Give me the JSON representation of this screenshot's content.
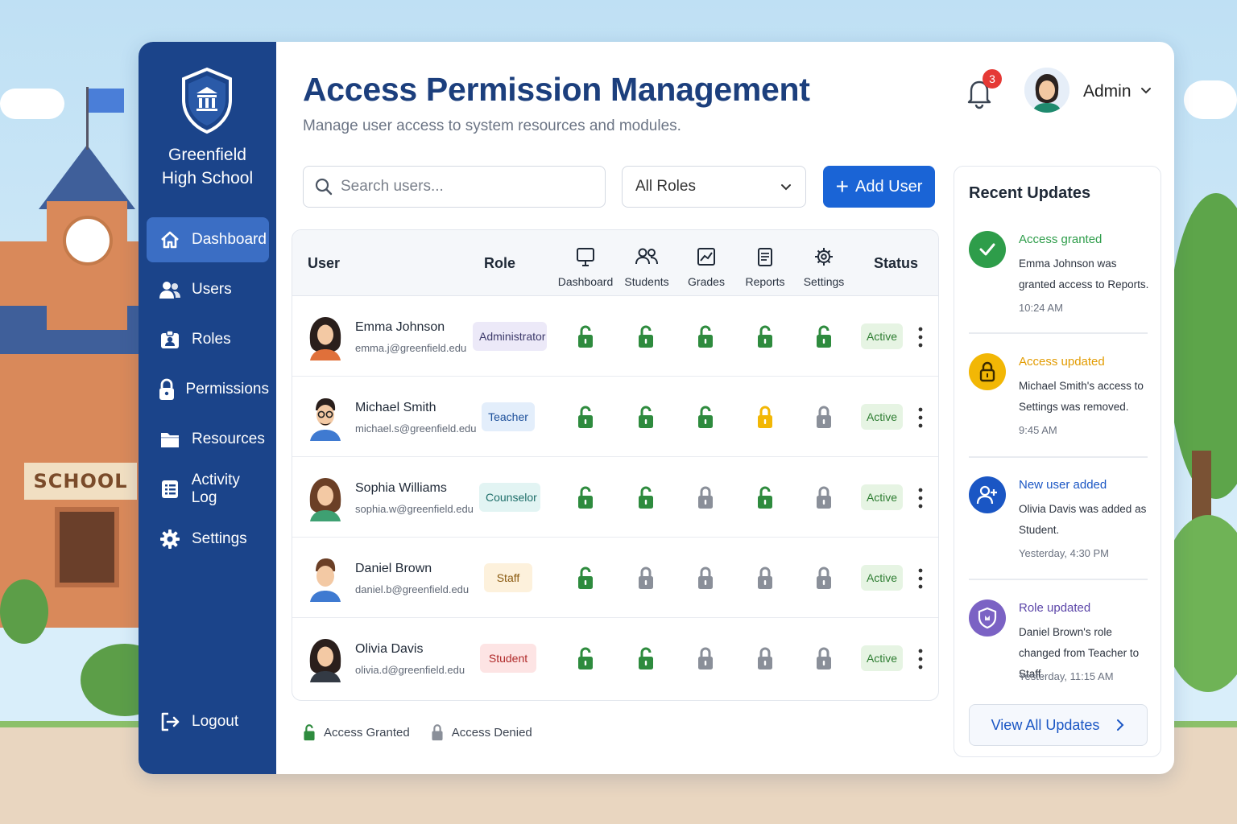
{
  "scene": {
    "sign_text": "SCHOOL"
  },
  "sidebar": {
    "school_name_line1": "Greenfield",
    "school_name_line2": "High School",
    "items": [
      {
        "label": "Dashboard",
        "icon": "home-icon",
        "active": true
      },
      {
        "label": "Users",
        "icon": "users-icon"
      },
      {
        "label": "Roles",
        "icon": "id-badge-icon"
      },
      {
        "label": "Permissions",
        "icon": "lock-icon"
      },
      {
        "label": "Resources",
        "icon": "folder-icon"
      },
      {
        "label": "Activity Log",
        "icon": "list-icon"
      },
      {
        "label": "Settings",
        "icon": "gear-icon"
      }
    ],
    "logout_label": "Logout"
  },
  "header": {
    "title": "Access Permission Management",
    "subtitle": "Manage user access to system resources and modules.",
    "notification_count": "3",
    "user_name": "Admin"
  },
  "controls": {
    "search_placeholder": "Search users...",
    "roles_filter": "All Roles",
    "add_user_label": "Add User"
  },
  "table": {
    "headers": {
      "user": "User",
      "role": "Role",
      "modules": [
        "Dashboard",
        "Students",
        "Grades",
        "Reports",
        "Settings"
      ],
      "status": "Status"
    },
    "rows": [
      {
        "name": "Emma Johnson",
        "email": "emma.j@greenfield.edu",
        "role": "Administrator",
        "access": [
          "granted",
          "granted",
          "granted",
          "granted",
          "granted"
        ],
        "status": "Active"
      },
      {
        "name": "Michael Smith",
        "email": "michael.s@greenfield.edu",
        "role": "Teacher",
        "access": [
          "granted",
          "granted",
          "granted",
          "partial",
          "denied"
        ],
        "status": "Active"
      },
      {
        "name": "Sophia Williams",
        "email": "sophia.w@greenfield.edu",
        "role": "Counselor",
        "access": [
          "granted",
          "granted",
          "denied",
          "granted",
          "denied"
        ],
        "status": "Active"
      },
      {
        "name": "Daniel Brown",
        "email": "daniel.b@greenfield.edu",
        "role": "Staff",
        "access": [
          "granted",
          "denied",
          "denied",
          "denied",
          "denied"
        ],
        "status": "Active"
      },
      {
        "name": "Olivia Davis",
        "email": "olivia.d@greenfield.edu",
        "role": "Student",
        "access": [
          "granted",
          "granted",
          "denied",
          "denied",
          "denied"
        ],
        "status": "Active"
      }
    ]
  },
  "legend": {
    "granted": "Access Granted",
    "denied": "Access Denied"
  },
  "updates": {
    "title": "Recent Updates",
    "items": [
      {
        "title": "Access granted",
        "text": "Emma Johnson was granted access to Reports.",
        "time": "10:24 AM",
        "color": "#2e9d4a",
        "icon": "check-icon"
      },
      {
        "title": "Access updated",
        "text": "Michael Smith's access to Settings was removed.",
        "time": "9:45 AM",
        "color": "#f2a900",
        "icon": "lock-icon"
      },
      {
        "title": "New user added",
        "text": "Olivia Davis was added as Student.",
        "time": "Yesterday, 4:30 PM",
        "color": "#1a56c4",
        "icon": "user-plus-icon"
      },
      {
        "title": "Role updated",
        "text": "Daniel Brown's role changed from Teacher to Staff.",
        "time": "Yesterday, 11:15 AM",
        "color": "#6b4fb8",
        "icon": "shield-icon"
      }
    ],
    "view_all_label": "View All Updates"
  },
  "colors": {
    "sidebar_bg": "#1b448a",
    "primary": "#1a64d6",
    "granted": "#2e8b3e",
    "partial": "#f2b705",
    "denied": "#8a8f99"
  }
}
